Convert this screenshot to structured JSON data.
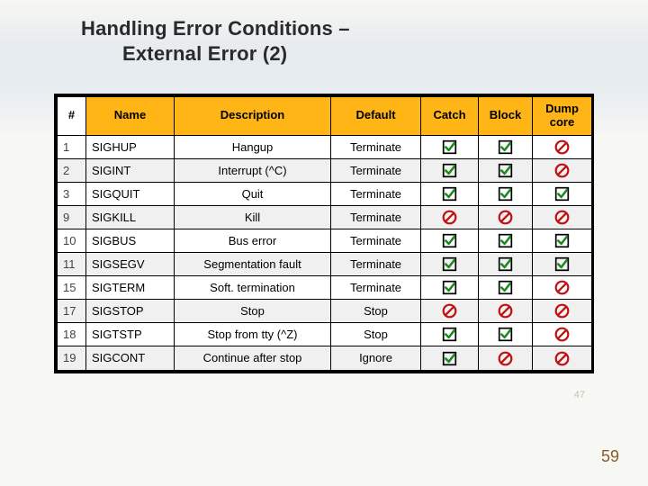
{
  "title_line1": "Handling Error Conditions –",
  "title_line2": "External Error (2)",
  "headers": {
    "num": "#",
    "name": "Name",
    "desc": "Description",
    "def": "Default",
    "catch": "Catch",
    "block": "Block",
    "dump": "Dump core"
  },
  "rows": [
    {
      "num": "1",
      "name": "SIGHUP",
      "desc": "Hangup",
      "def": "Terminate",
      "catch": "yes",
      "block": "yes",
      "dump": "no"
    },
    {
      "num": "2",
      "name": "SIGINT",
      "desc": "Interrupt (^C)",
      "def": "Terminate",
      "catch": "yes",
      "block": "yes",
      "dump": "no"
    },
    {
      "num": "3",
      "name": "SIGQUIT",
      "desc": "Quit",
      "def": "Terminate",
      "catch": "yes",
      "block": "yes",
      "dump": "yes"
    },
    {
      "num": "9",
      "name": "SIGKILL",
      "desc": "Kill",
      "def": "Terminate",
      "catch": "no",
      "block": "no",
      "dump": "no"
    },
    {
      "num": "10",
      "name": "SIGBUS",
      "desc": "Bus error",
      "def": "Terminate",
      "catch": "yes",
      "block": "yes",
      "dump": "yes"
    },
    {
      "num": "11",
      "name": "SIGSEGV",
      "desc": "Segmentation fault",
      "def": "Terminate",
      "catch": "yes",
      "block": "yes",
      "dump": "yes"
    },
    {
      "num": "15",
      "name": "SIGTERM",
      "desc": "Soft. termination",
      "def": "Terminate",
      "catch": "yes",
      "block": "yes",
      "dump": "no"
    },
    {
      "num": "17",
      "name": "SIGSTOP",
      "desc": "Stop",
      "def": "Stop",
      "catch": "no",
      "block": "no",
      "dump": "no"
    },
    {
      "num": "18",
      "name": "SIGTSTP",
      "desc": "Stop from tty (^Z)",
      "def": "Stop",
      "catch": "yes",
      "block": "yes",
      "dump": "no"
    },
    {
      "num": "19",
      "name": "SIGCONT",
      "desc": "Continue after stop",
      "def": "Ignore",
      "catch": "yes",
      "block": "no",
      "dump": "no"
    }
  ],
  "tiny_num": "47",
  "page_num": "59",
  "icons": {
    "yes_label": "checked-box",
    "no_label": "prohibited"
  }
}
